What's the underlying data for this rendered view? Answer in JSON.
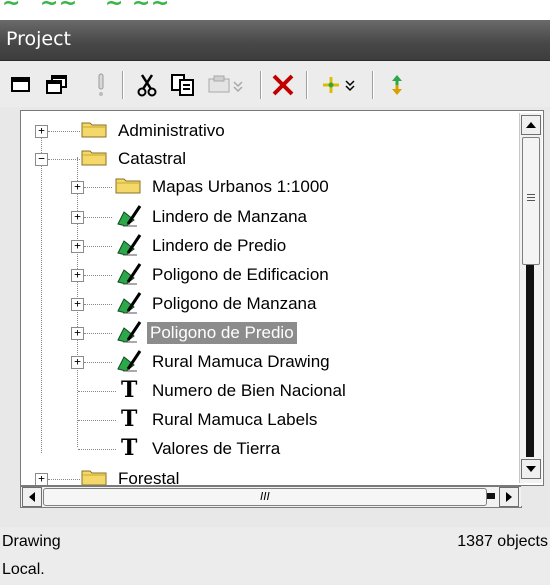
{
  "window": {
    "title": "Project"
  },
  "toolbar": {
    "buttons": [
      {
        "name": "window-restore-icon"
      },
      {
        "name": "cascade-windows-icon"
      },
      {
        "name": "properties-icon"
      },
      {
        "name": "cut-icon"
      },
      {
        "name": "copy-icon"
      },
      {
        "name": "paste-icon"
      },
      {
        "name": "delete-icon"
      },
      {
        "name": "add-component-icon"
      },
      {
        "name": "refresh-icon"
      }
    ]
  },
  "tree": {
    "items": [
      {
        "label": "Administrativo",
        "icon": "folder-icon",
        "level": 0,
        "expander": "+"
      },
      {
        "label": "Catastral",
        "icon": "folder-icon",
        "level": 0,
        "expander": "-"
      },
      {
        "label": "Mapas Urbanos 1:1000",
        "icon": "folder-icon",
        "level": 1,
        "expander": "+"
      },
      {
        "label": "Lindero de Manzana",
        "icon": "drawing-icon",
        "level": 1,
        "expander": "+"
      },
      {
        "label": "Lindero de Predio",
        "icon": "drawing-icon",
        "level": 1,
        "expander": "+"
      },
      {
        "label": "Poligono de Edificacion",
        "icon": "drawing-icon",
        "level": 1,
        "expander": "+"
      },
      {
        "label": "Poligono de Manzana",
        "icon": "drawing-icon",
        "level": 1,
        "expander": "+"
      },
      {
        "label": "Poligono de Predio",
        "icon": "drawing-icon",
        "level": 1,
        "expander": "+",
        "selected": true
      },
      {
        "label": "Rural Mamuca Drawing",
        "icon": "drawing-icon",
        "level": 1,
        "expander": "+"
      },
      {
        "label": "Numero de Bien Nacional",
        "icon": "labels-icon",
        "level": 1,
        "expander": ""
      },
      {
        "label": "Rural Mamuca Labels",
        "icon": "labels-icon",
        "level": 1,
        "expander": ""
      },
      {
        "label": "Valores de Tierra",
        "icon": "labels-icon",
        "level": 1,
        "expander": ""
      },
      {
        "label": "Forestal",
        "icon": "folder-icon",
        "level": 0,
        "expander": "+"
      }
    ]
  },
  "hscroll": {
    "thumb_grip": "III"
  },
  "status": {
    "type": "Drawing",
    "count": "1387 objects",
    "location": "Local."
  },
  "colors": {
    "titlebar": "#474747",
    "selection": "#8c8c8c",
    "folder": "#f5d86a",
    "drawing_green": "#2ca84a"
  }
}
